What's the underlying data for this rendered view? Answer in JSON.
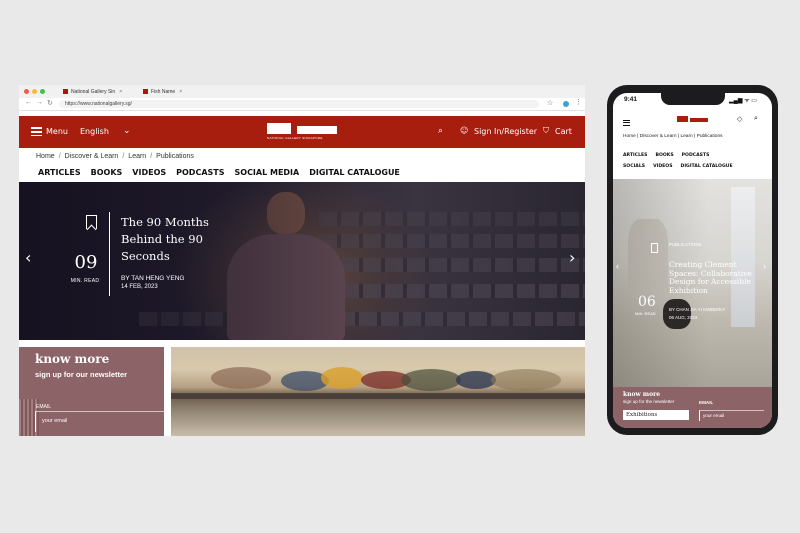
{
  "desktop": {
    "tabs": [
      {
        "label": "National Gallery Sin",
        "close": "×"
      },
      {
        "label": "Fish Name",
        "close": "×"
      }
    ],
    "url": "https://www.nationalgallery.sg/",
    "nav_buttons": {
      "back": "←",
      "forward": "→",
      "reload": "↻"
    },
    "header": {
      "menu_label": "Menu",
      "language": "English",
      "logo_text": "NATIONAL GALLERY SINGAPORE",
      "sign_in": "Sign In/Register",
      "cart": "Cart",
      "brand_color": "#a71d0e"
    },
    "breadcrumb": [
      "Home",
      "Discover & Learn",
      "Learn",
      "Publications"
    ],
    "subnav": [
      "ARTICLES",
      "BOOKS",
      "VIDEOS",
      "PODCASTS",
      "SOCIAL MEDIA",
      "DIGITAL CATALOGUE"
    ],
    "hero": {
      "title": "The 90 Months Behind the 90 Seconds",
      "read_number": "09",
      "read_unit": "MIN. READ",
      "author": "BY TAN HENG YENG",
      "date": "14 FEB, 2023",
      "prev": "‹",
      "next": "›"
    },
    "newsletter": {
      "heading": "know more",
      "subheading": "sign up for our newsletter",
      "email_label": "EMAIL",
      "email_placeholder": "your email",
      "color": "#8c6366"
    }
  },
  "phone": {
    "time": "9:41",
    "status": "▂▄▆ ᯤ ▭",
    "breadcrumb": [
      "Home",
      "Discover & Learn",
      "Learn",
      "Publications"
    ],
    "nav_row1": [
      "ARTICLES",
      "BOOKS",
      "PODCASTS"
    ],
    "nav_row2": [
      "SOCIALS",
      "VIDEOS",
      "DIGITAL CATALOGUE"
    ],
    "hero": {
      "category": "PUBLICATIONS",
      "title": "Creating Clement Spaces: Collaborative Design for Accessible Exhibition",
      "read_number": "06",
      "read_unit": "MIN. READ",
      "author": "BY CHAN JIA YI KIMBERLY",
      "date": "06 AUG, 2023"
    },
    "newsletter": {
      "heading": "know more",
      "subheading": "sign up for the newsletter",
      "email_label": "EMAIL",
      "topic_select": "Exhibitions",
      "email_placeholder": "your email"
    }
  }
}
